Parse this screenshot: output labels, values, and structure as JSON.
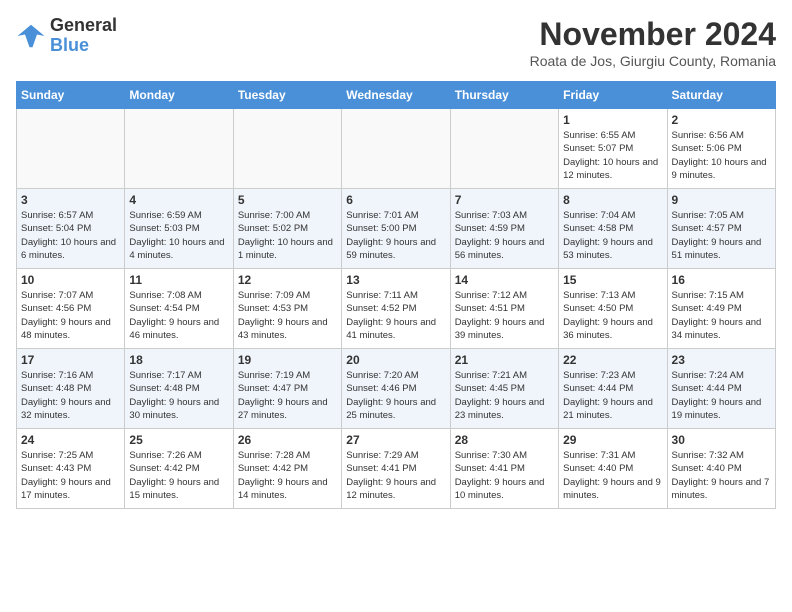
{
  "logo": {
    "general": "General",
    "blue": "Blue"
  },
  "title": "November 2024",
  "location": "Roata de Jos, Giurgiu County, Romania",
  "days_of_week": [
    "Sunday",
    "Monday",
    "Tuesday",
    "Wednesday",
    "Thursday",
    "Friday",
    "Saturday"
  ],
  "weeks": [
    [
      {
        "day": "",
        "info": ""
      },
      {
        "day": "",
        "info": ""
      },
      {
        "day": "",
        "info": ""
      },
      {
        "day": "",
        "info": ""
      },
      {
        "day": "",
        "info": ""
      },
      {
        "day": "1",
        "info": "Sunrise: 6:55 AM\nSunset: 5:07 PM\nDaylight: 10 hours and 12 minutes."
      },
      {
        "day": "2",
        "info": "Sunrise: 6:56 AM\nSunset: 5:06 PM\nDaylight: 10 hours and 9 minutes."
      }
    ],
    [
      {
        "day": "3",
        "info": "Sunrise: 6:57 AM\nSunset: 5:04 PM\nDaylight: 10 hours and 6 minutes."
      },
      {
        "day": "4",
        "info": "Sunrise: 6:59 AM\nSunset: 5:03 PM\nDaylight: 10 hours and 4 minutes."
      },
      {
        "day": "5",
        "info": "Sunrise: 7:00 AM\nSunset: 5:02 PM\nDaylight: 10 hours and 1 minute."
      },
      {
        "day": "6",
        "info": "Sunrise: 7:01 AM\nSunset: 5:00 PM\nDaylight: 9 hours and 59 minutes."
      },
      {
        "day": "7",
        "info": "Sunrise: 7:03 AM\nSunset: 4:59 PM\nDaylight: 9 hours and 56 minutes."
      },
      {
        "day": "8",
        "info": "Sunrise: 7:04 AM\nSunset: 4:58 PM\nDaylight: 9 hours and 53 minutes."
      },
      {
        "day": "9",
        "info": "Sunrise: 7:05 AM\nSunset: 4:57 PM\nDaylight: 9 hours and 51 minutes."
      }
    ],
    [
      {
        "day": "10",
        "info": "Sunrise: 7:07 AM\nSunset: 4:56 PM\nDaylight: 9 hours and 48 minutes."
      },
      {
        "day": "11",
        "info": "Sunrise: 7:08 AM\nSunset: 4:54 PM\nDaylight: 9 hours and 46 minutes."
      },
      {
        "day": "12",
        "info": "Sunrise: 7:09 AM\nSunset: 4:53 PM\nDaylight: 9 hours and 43 minutes."
      },
      {
        "day": "13",
        "info": "Sunrise: 7:11 AM\nSunset: 4:52 PM\nDaylight: 9 hours and 41 minutes."
      },
      {
        "day": "14",
        "info": "Sunrise: 7:12 AM\nSunset: 4:51 PM\nDaylight: 9 hours and 39 minutes."
      },
      {
        "day": "15",
        "info": "Sunrise: 7:13 AM\nSunset: 4:50 PM\nDaylight: 9 hours and 36 minutes."
      },
      {
        "day": "16",
        "info": "Sunrise: 7:15 AM\nSunset: 4:49 PM\nDaylight: 9 hours and 34 minutes."
      }
    ],
    [
      {
        "day": "17",
        "info": "Sunrise: 7:16 AM\nSunset: 4:48 PM\nDaylight: 9 hours and 32 minutes."
      },
      {
        "day": "18",
        "info": "Sunrise: 7:17 AM\nSunset: 4:48 PM\nDaylight: 9 hours and 30 minutes."
      },
      {
        "day": "19",
        "info": "Sunrise: 7:19 AM\nSunset: 4:47 PM\nDaylight: 9 hours and 27 minutes."
      },
      {
        "day": "20",
        "info": "Sunrise: 7:20 AM\nSunset: 4:46 PM\nDaylight: 9 hours and 25 minutes."
      },
      {
        "day": "21",
        "info": "Sunrise: 7:21 AM\nSunset: 4:45 PM\nDaylight: 9 hours and 23 minutes."
      },
      {
        "day": "22",
        "info": "Sunrise: 7:23 AM\nSunset: 4:44 PM\nDaylight: 9 hours and 21 minutes."
      },
      {
        "day": "23",
        "info": "Sunrise: 7:24 AM\nSunset: 4:44 PM\nDaylight: 9 hours and 19 minutes."
      }
    ],
    [
      {
        "day": "24",
        "info": "Sunrise: 7:25 AM\nSunset: 4:43 PM\nDaylight: 9 hours and 17 minutes."
      },
      {
        "day": "25",
        "info": "Sunrise: 7:26 AM\nSunset: 4:42 PM\nDaylight: 9 hours and 15 minutes."
      },
      {
        "day": "26",
        "info": "Sunrise: 7:28 AM\nSunset: 4:42 PM\nDaylight: 9 hours and 14 minutes."
      },
      {
        "day": "27",
        "info": "Sunrise: 7:29 AM\nSunset: 4:41 PM\nDaylight: 9 hours and 12 minutes."
      },
      {
        "day": "28",
        "info": "Sunrise: 7:30 AM\nSunset: 4:41 PM\nDaylight: 9 hours and 10 minutes."
      },
      {
        "day": "29",
        "info": "Sunrise: 7:31 AM\nSunset: 4:40 PM\nDaylight: 9 hours and 9 minutes."
      },
      {
        "day": "30",
        "info": "Sunrise: 7:32 AM\nSunset: 4:40 PM\nDaylight: 9 hours and 7 minutes."
      }
    ]
  ]
}
